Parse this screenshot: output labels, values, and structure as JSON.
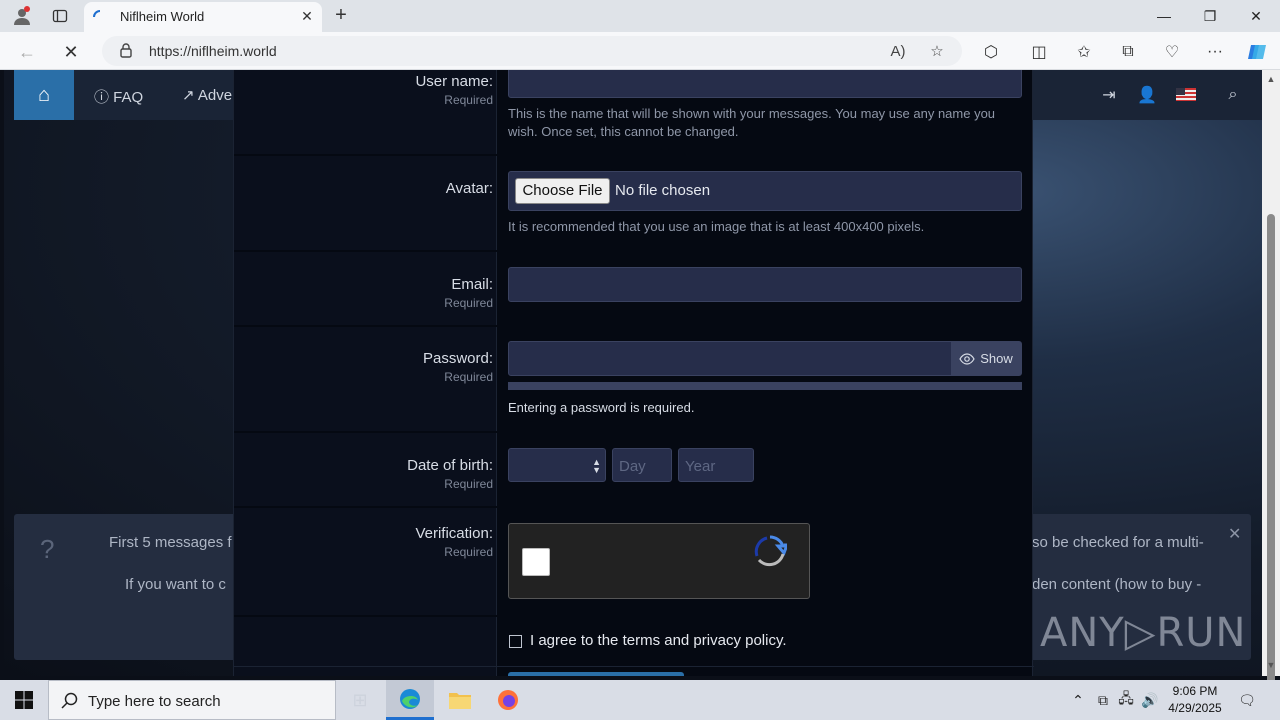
{
  "browser": {
    "tab_title": "Niflheim World",
    "url": "https://niflheim.world"
  },
  "site_nav": {
    "faq_label": "FAQ",
    "adv_label": "Adve"
  },
  "form": {
    "username_label": "User name:",
    "username_req": "Required",
    "username_hint": "This is the name that will be shown with your messages. You may use any name you wish. Once set, this cannot be changed.",
    "avatar_label": "Avatar:",
    "choose_file": "Choose File",
    "no_file": "No file chosen",
    "avatar_hint": "It is recommended that you use an image that is at least 400x400 pixels.",
    "email_label": "Email:",
    "email_req": "Required",
    "password_label": "Password:",
    "password_req": "Required",
    "show_label": "Show",
    "password_hint": "Entering a password is required.",
    "dob_label": "Date of birth:",
    "dob_req": "Required",
    "day_placeholder": "Day",
    "year_placeholder": "Year",
    "verification_label": "Verification:",
    "verification_req": "Required",
    "agree_text": "I agree to the terms and privacy policy."
  },
  "notice": {
    "line1_start": "First 5 messages f",
    "line2_start": "If you want to c",
    "line1_end": "so be checked for a multi-",
    "line2_end": "den content (how to buy -"
  },
  "watermark": "ANY▷RUN",
  "taskbar": {
    "search_placeholder": "Type here to search",
    "time": "9:06 PM",
    "date": "4/29/2025"
  }
}
